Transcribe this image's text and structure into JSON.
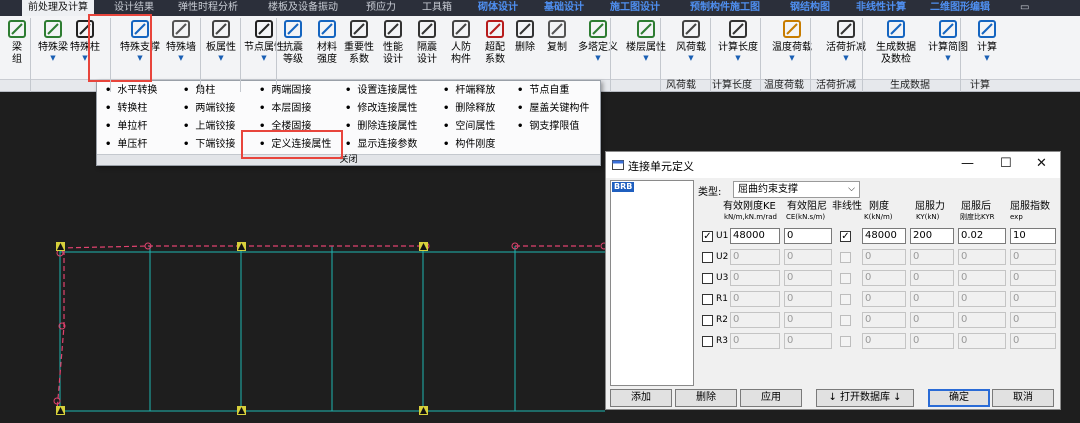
{
  "menu": {
    "tabs": [
      {
        "label": "前处理及计算",
        "active": true
      },
      {
        "label": "设计结果"
      },
      {
        "label": "弹性时程分析"
      },
      {
        "label": "楼板及设备振动"
      },
      {
        "label": "预应力"
      },
      {
        "label": "工具箱"
      },
      {
        "label": "砌体设计",
        "blue": true
      },
      {
        "label": "基础设计",
        "blue": true
      },
      {
        "label": "施工图设计",
        "blue": true
      },
      {
        "label": "预制构件施工图",
        "blue": true
      },
      {
        "label": "钢结构图",
        "blue": true
      },
      {
        "label": "非线性计算",
        "blue": true
      },
      {
        "label": "二维图形编辑",
        "blue": true
      }
    ]
  },
  "ribbon": {
    "buttons": [
      {
        "label": "梁\n组"
      },
      {
        "label": "特殊梁",
        "arrow": true
      },
      {
        "label": "特殊柱",
        "arrow": true
      },
      {
        "label": "特殊支撑",
        "arrow": true
      },
      {
        "label": "特殊墙",
        "arrow": true
      },
      {
        "label": "板属性",
        "arrow": true
      },
      {
        "label": "节点属性",
        "arrow": true
      },
      {
        "label": "抗震\n等级"
      },
      {
        "label": "材料\n强度"
      },
      {
        "label": "重要性\n系数"
      },
      {
        "label": "性能\n设计"
      },
      {
        "label": "隔震\n设计"
      },
      {
        "label": "人防\n构件"
      },
      {
        "label": "超配\n系数"
      },
      {
        "label": "删除"
      },
      {
        "label": "复制"
      },
      {
        "label": "多塔定义",
        "arrow": true
      },
      {
        "label": "楼层属性",
        "arrow": true
      },
      {
        "label": "风荷载",
        "arrow": true
      },
      {
        "label": "计算长度",
        "arrow": true
      },
      {
        "label": "温度荷载",
        "arrow": true
      },
      {
        "label": "活荷折减",
        "arrow": true
      },
      {
        "label": "生成数据\n及数检"
      },
      {
        "label": "计算简图",
        "arrow": true
      },
      {
        "label": "计算",
        "arrow": true
      }
    ],
    "groups": [
      "风荷载",
      "计算长度",
      "温度荷载",
      "活荷折减",
      "生成数据",
      "计算"
    ]
  },
  "dropdown": {
    "columns": [
      [
        "水平转换",
        "转换柱",
        "单拉杆",
        "单压杆"
      ],
      [
        "角柱",
        "两端铰接",
        "上端铰接",
        "下端铰接"
      ],
      [
        "两端固接",
        "本层固接",
        "全楼固接",
        "定义连接属性"
      ],
      [
        "设置连接属性",
        "修改连接属性",
        "删除连接属性",
        "显示连接参数"
      ],
      [
        "杆端释放",
        "删除释放",
        "空间属性",
        "构件刚度"
      ],
      [
        "节点自重",
        "屋盖关键构件",
        "钢支撑限值"
      ]
    ],
    "close_label": "关闭"
  },
  "dialog": {
    "title": "连接单元定义",
    "list_item": "BRB",
    "type_label": "类型:",
    "type_value": "屈曲约束支撑",
    "headers": {
      "k_eff": "有效刚度KE",
      "k_eff_unit": "kN/m,kN.m/rad",
      "c_eff": "有效阻尼",
      "c_eff_unit": "CE(kN.s/m)",
      "nonlinear": "非线性",
      "stiffness": "刚度",
      "stiffness_unit": "K(kN/m)",
      "yield": "屈服力",
      "yield_unit": "KY(kN)",
      "post_yield": "屈服后",
      "post_yield_unit": "刚度比KYR",
      "yield_exp": "屈服指数",
      "yield_exp_unit": "exp"
    },
    "rows": [
      {
        "label": "U1",
        "checked": true,
        "enabled": true,
        "ke": "48000",
        "ce": "0",
        "nl": true,
        "k": "48000",
        "ky": "200",
        "kyr": "0.02",
        "exp": "10"
      },
      {
        "label": "U2",
        "checked": false,
        "enabled": false,
        "ke": "0",
        "ce": "0",
        "nl": false,
        "k": "0",
        "ky": "0",
        "kyr": "0",
        "exp": "0"
      },
      {
        "label": "U3",
        "checked": false,
        "enabled": false,
        "ke": "0",
        "ce": "0",
        "nl": false,
        "k": "0",
        "ky": "0",
        "kyr": "0",
        "exp": "0"
      },
      {
        "label": "R1",
        "checked": false,
        "enabled": false,
        "ke": "0",
        "ce": "0",
        "nl": false,
        "k": "0",
        "ky": "0",
        "kyr": "0",
        "exp": "0"
      },
      {
        "label": "R2",
        "checked": false,
        "enabled": false,
        "ke": "0",
        "ce": "0",
        "nl": false,
        "k": "0",
        "ky": "0",
        "kyr": "0",
        "exp": "0"
      },
      {
        "label": "R3",
        "checked": false,
        "enabled": false,
        "ke": "0",
        "ce": "0",
        "nl": false,
        "k": "0",
        "ky": "0",
        "kyr": "0",
        "exp": "0"
      }
    ],
    "buttons": {
      "add": "添加",
      "delete": "删除",
      "apply": "应用",
      "open_db": "↓ 打开数据库 ↓",
      "ok": "确定",
      "cancel": "取消"
    }
  },
  "colors": {
    "highlight": "#e8453c",
    "grid": "#1fb5b0",
    "brace": "#e0426e",
    "canvas_bg": "#1e1e1e"
  }
}
